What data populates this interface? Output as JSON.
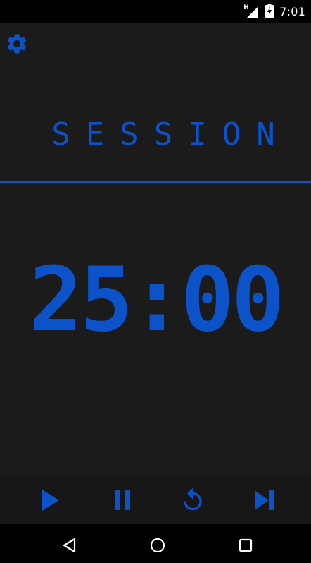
{
  "status_bar": {
    "time": "7:01",
    "signal_badge": "H",
    "icons": [
      "signal-icon",
      "battery-charging-icon"
    ]
  },
  "header": {
    "settings_icon": "gear-icon",
    "session_label": "SESSION"
  },
  "timer": {
    "display": "25:00"
  },
  "controls": {
    "buttons": [
      "play-icon",
      "pause-icon",
      "reset-icon",
      "skip-next-icon"
    ]
  },
  "navigation": {
    "buttons": [
      "back-icon",
      "home-icon",
      "recents-icon"
    ]
  },
  "colors": {
    "accent": "#0c52c8",
    "background": "#1b1b1b",
    "controls_bar": "#171717",
    "system_bars": "#000000"
  }
}
